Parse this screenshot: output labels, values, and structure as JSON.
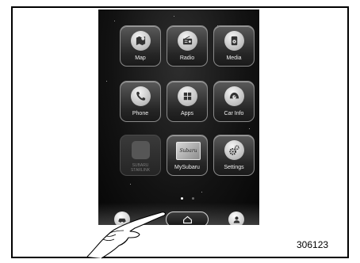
{
  "apps": [
    {
      "label": "Map",
      "icon": "map-icon"
    },
    {
      "label": "Radio",
      "icon": "radio-icon"
    },
    {
      "label": "Media",
      "icon": "media-icon"
    },
    {
      "label": "Phone",
      "icon": "phone-icon"
    },
    {
      "label": "Apps",
      "icon": "apps-grid-icon"
    },
    {
      "label": "Car Info",
      "icon": "car-info-icon"
    },
    {
      "label": "SUBARU STARLINK",
      "icon": "starlink-placeholder-icon",
      "disabled": true
    },
    {
      "label": "MySubaru",
      "icon": "mysubaru-card-icon",
      "card_text": "Subaru"
    },
    {
      "label": "Settings",
      "icon": "gears-icon"
    }
  ],
  "page_indicator": {
    "pages": 2,
    "current": 1
  },
  "bottom_bar": {
    "left_icon": "car-icon",
    "center_icon": "home-icon",
    "right_icon": "user-icon"
  },
  "figure_number": "306123",
  "colors": {
    "screen_bg": "#121212",
    "tile_border": "#8a8a8a",
    "label": "#f0f0f0"
  }
}
